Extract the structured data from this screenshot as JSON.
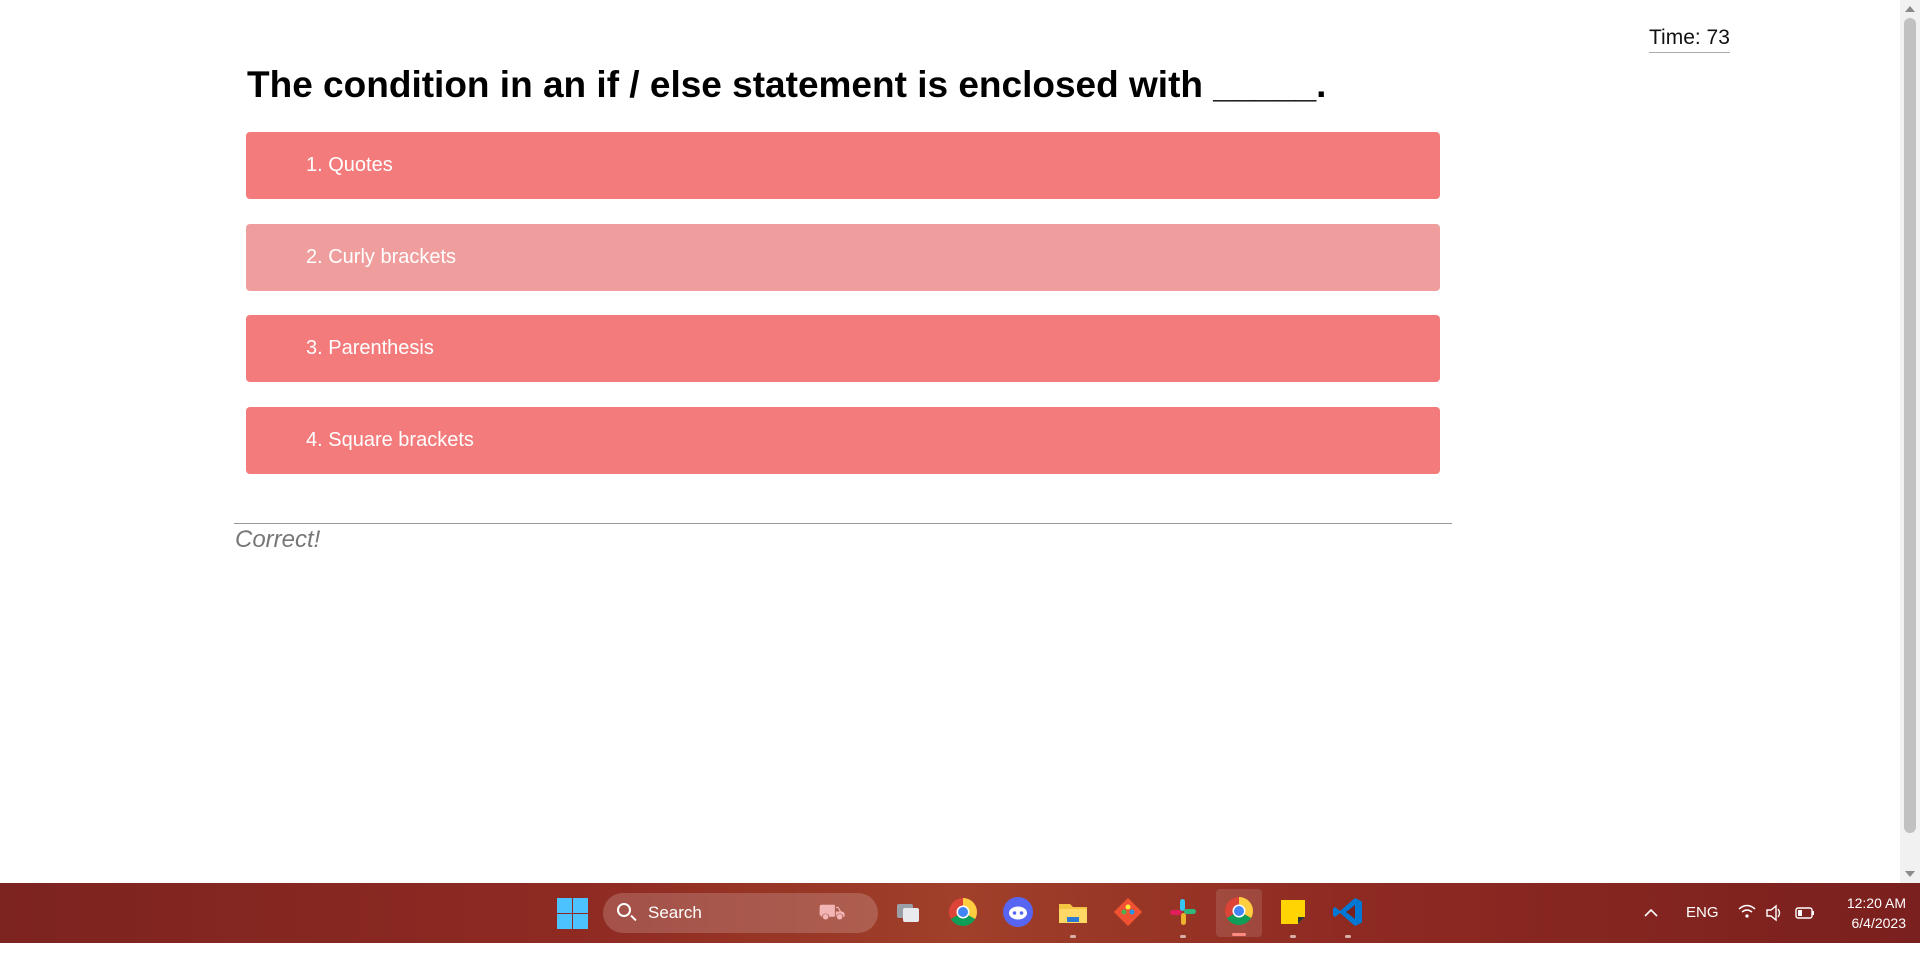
{
  "quiz": {
    "timer_label": "Time: 73",
    "question": "The condition in an if / else statement is enclosed with _____.",
    "answers": [
      {
        "label": "1. Quotes"
      },
      {
        "label": "2. Curly brackets"
      },
      {
        "label": "3. Parenthesis"
      },
      {
        "label": "4. Square brackets"
      }
    ],
    "hovered_answer_index": 1,
    "feedback": "Correct!",
    "colors": {
      "answer": "#f37b7b",
      "answer_hover": "#ef9d9d"
    }
  },
  "taskbar": {
    "search_placeholder": "Search",
    "apps": [
      "task-view",
      "chrome",
      "discord",
      "file-explorer",
      "git",
      "slack",
      "chrome-active",
      "sticky-notes",
      "vscode"
    ],
    "language": "ENG",
    "time": "12:20 AM",
    "date": "6/4/2023"
  }
}
